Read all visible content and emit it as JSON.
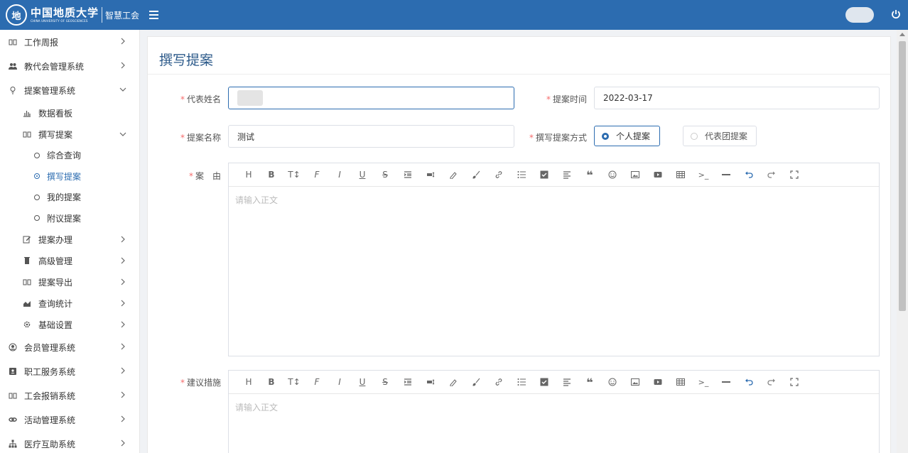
{
  "header": {
    "logo_seal": "地",
    "logo_cn": "中国地质大学",
    "logo_en": "CHINA UNIVERSITY OF GEOSCIENCES",
    "subtitle": "智慧工会",
    "accent": "#2c6cb0"
  },
  "sidebar": {
    "items": [
      {
        "label": "工作周报",
        "icon": "book-icon"
      },
      {
        "label": "教代会管理系统",
        "icon": "users-icon"
      },
      {
        "label": "提案管理系统",
        "icon": "bulb-icon",
        "expanded": true
      }
    ],
    "sub_items": [
      {
        "label": "数据看板",
        "icon": "bar-chart-icon"
      },
      {
        "label": "撰写提案",
        "icon": "book-icon",
        "expanded": true
      }
    ],
    "leaf_items": [
      {
        "label": "综合查询"
      },
      {
        "label": "撰写提案",
        "active": true
      },
      {
        "label": "我的提案"
      },
      {
        "label": "附议提案"
      }
    ],
    "sub_items2": [
      {
        "label": "提案办理",
        "icon": "edit-icon"
      },
      {
        "label": "高级管理",
        "icon": "trash-icon"
      },
      {
        "label": "提案导出",
        "icon": "book-icon"
      },
      {
        "label": "查询统计",
        "icon": "area-chart-icon"
      },
      {
        "label": "基础设置",
        "icon": "gear-icon"
      }
    ],
    "items2": [
      {
        "label": "会员管理系统",
        "icon": "user-circle-icon"
      },
      {
        "label": "职工服务系统",
        "icon": "id-card-icon"
      },
      {
        "label": "工会报销系统",
        "icon": "book-icon"
      },
      {
        "label": "活动管理系统",
        "icon": "link-icon"
      },
      {
        "label": "医疗互助系统",
        "icon": "org-icon"
      }
    ]
  },
  "page": {
    "title": "撰写提案"
  },
  "form": {
    "rep_name_label": "代表姓名",
    "time_label": "提案时间",
    "time_value": "2022-03-17",
    "proposal_name_label": "提案名称",
    "proposal_name_value": "测试",
    "mode_label": "撰写提案方式",
    "mode_options": [
      "个人提案",
      "代表团提案"
    ],
    "reason_label": "案　由",
    "measures_label": "建议措施",
    "editor_placeholder": "请输入正文"
  }
}
